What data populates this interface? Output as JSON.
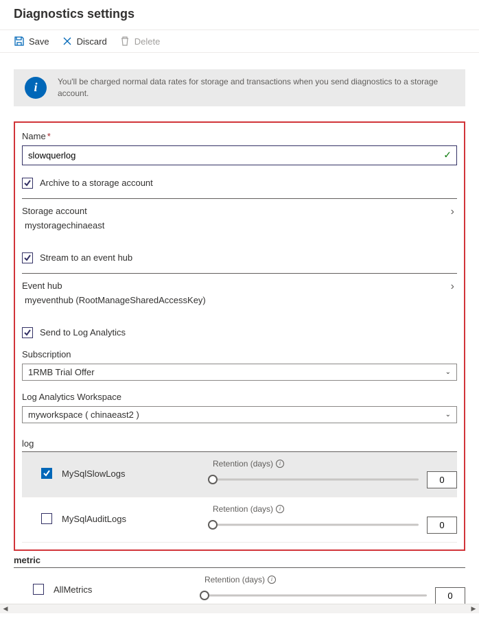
{
  "header": {
    "title": "Diagnostics settings"
  },
  "toolbar": {
    "save_label": "Save",
    "discard_label": "Discard",
    "delete_label": "Delete"
  },
  "info": {
    "message": "You'll be charged normal data rates for storage and transactions when you send diagnostics to a storage account."
  },
  "name": {
    "label": "Name",
    "value": "slowquerlog",
    "required": true
  },
  "archive": {
    "checkbox_label": "Archive to a storage account",
    "checked": true,
    "picker_label": "Storage account",
    "picker_value": "mystoragechinaeast"
  },
  "stream": {
    "checkbox_label": "Stream to an event hub",
    "checked": true,
    "picker_label": "Event hub",
    "picker_value": "myeventhub (RootManageSharedAccessKey)"
  },
  "loganalytics": {
    "checkbox_label": "Send to Log Analytics",
    "checked": true,
    "subscription_label": "Subscription",
    "subscription_value": "1RMB Trial Offer",
    "workspace_label": "Log Analytics Workspace",
    "workspace_value": "myworkspace ( chinaeast2 )"
  },
  "log_section": {
    "title": "log",
    "retention_label": "Retention (days)",
    "rows": [
      {
        "name": "MySqlSlowLogs",
        "checked": true,
        "retention": "0"
      },
      {
        "name": "MySqlAuditLogs",
        "checked": false,
        "retention": "0"
      }
    ]
  },
  "metric_section": {
    "title": "metric",
    "retention_label": "Retention (days)",
    "rows": [
      {
        "name": "AllMetrics",
        "checked": false,
        "retention": "0"
      }
    ]
  }
}
